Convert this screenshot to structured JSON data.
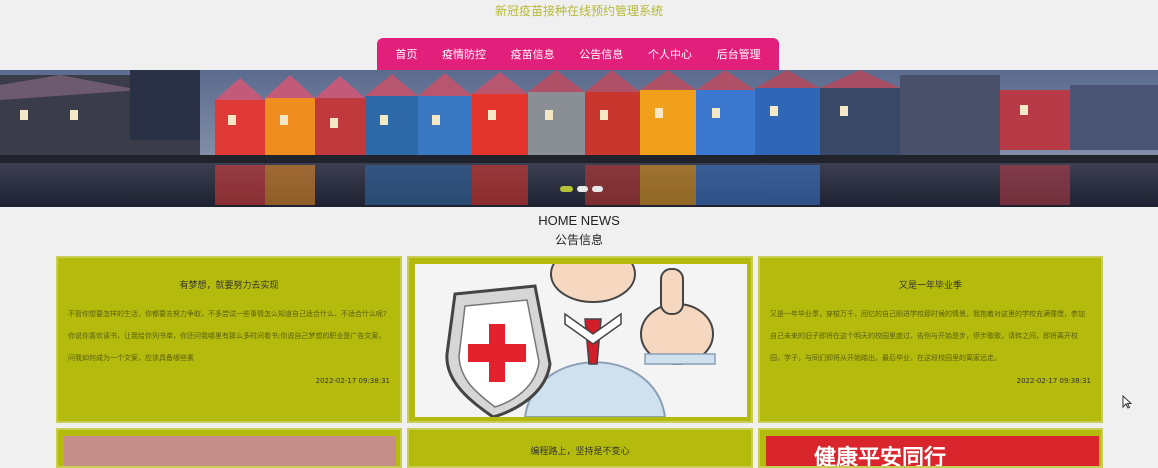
{
  "site": {
    "title": "新冠疫苗接种在线预约管理系统"
  },
  "nav": {
    "items": [
      {
        "label": "首页"
      },
      {
        "label": "疫情防控"
      },
      {
        "label": "疫苗信息"
      },
      {
        "label": "公告信息"
      },
      {
        "label": "个人中心"
      },
      {
        "label": "后台管理"
      }
    ]
  },
  "carousel": {
    "slide_count": 3,
    "active_index": 0
  },
  "section": {
    "heading_en": "HOME NEWS",
    "heading_zh": "公告信息"
  },
  "news": [
    {
      "title": "有梦想，就要努力去实现",
      "excerpt": "不管你想要怎样的生活，你都要去努力争取，不多尝试一些事情怎么知道自己适合什么、不适合什么呢?你说你喜欢读书，让我给你列书单，你还问我哪里有那么多时间看书;你说自己梦想的职业是广告文案，问我如何成为一个文案，应该具备哪些素",
      "date": "2022-02-17 09:38:31"
    },
    {
      "title": "又是一年毕业季",
      "excerpt": "又是一年毕业季，穿梭万千，回忆的自己刚进学校那时候的情景，我抱着对这里的学校充满憧憬，参加自己未来的旧子即将在这个明天的校园里度过，告别与开始是步，停步歌歌，请转之间，即将离开校园，学子，与同们即将从开始踏出，最后毕业，在这段校园里的离家远走。",
      "date": "2022-02-17 09:38:31"
    }
  ],
  "partial_cards": [
    {
      "title": "编程路上，坚持是不变心"
    },
    {
      "banner_text": "健康平安同行"
    }
  ],
  "colors": {
    "nav_bg": "#e21f7a",
    "card_bg": "#b4bb0c",
    "title_color": "#b4ba39",
    "page_bg": "#f1f0f0"
  },
  "icons": {
    "cursor": "arrow-cursor-icon"
  }
}
